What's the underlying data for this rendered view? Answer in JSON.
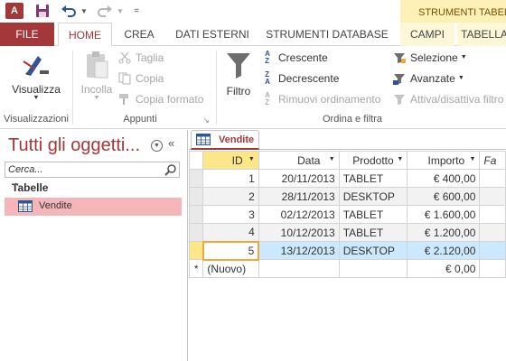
{
  "app": {
    "logo": "A",
    "context_tools_label": "STRUMENTI TABELLA"
  },
  "quick_access": {
    "save": "save-icon",
    "undo": "undo-icon",
    "redo": "redo-icon"
  },
  "tabs": {
    "file": "FILE",
    "home": "HOME",
    "crea": "CREA",
    "dati_esterni": "DATI ESTERNI",
    "strumenti_database": "STRUMENTI DATABASE",
    "campi": "CAMPI",
    "tabella": "TABELLA"
  },
  "ribbon": {
    "visualizzazioni": {
      "label": "Visualizzazioni",
      "visualizza": "Visualizza"
    },
    "appunti": {
      "label": "Appunti",
      "incolla": "Incolla",
      "taglia": "Taglia",
      "copia": "Copia",
      "copia_formato": "Copia formato"
    },
    "ordina": {
      "label": "Ordina e filtra",
      "filtro": "Filtro",
      "crescente": "Crescente",
      "decrescente": "Decrescente",
      "rimuovi": "Rimuovi ordinamento",
      "selezione": "Selezione",
      "avanzate": "Avanzate",
      "attiva": "Attiva/disattiva filtro"
    }
  },
  "nav": {
    "title": "Tutti gli oggetti...",
    "search_placeholder": "Cerca...",
    "group": "Tabelle",
    "items": [
      "Vendite"
    ]
  },
  "document": {
    "tab_label": "Vendite",
    "columns": [
      "ID",
      "Data",
      "Prodotto",
      "Importo",
      "Fa"
    ],
    "rows": [
      {
        "id": "1",
        "data": "20/11/2013",
        "prodotto": "TABLET",
        "importo": "€ 400,00"
      },
      {
        "id": "2",
        "data": "28/11/2013",
        "prodotto": "DESKTOP",
        "importo": "€ 600,00"
      },
      {
        "id": "3",
        "data": "02/12/2013",
        "prodotto": "TABLET",
        "importo": "€ 1.600,00"
      },
      {
        "id": "4",
        "data": "10/12/2013",
        "prodotto": "TABLET",
        "importo": "€ 1.200,00"
      },
      {
        "id": "5",
        "data": "13/12/2013",
        "prodotto": "DESKTOP",
        "importo": "€ 2.120,00"
      }
    ],
    "new_row": {
      "marker": "*",
      "id": "(Nuovo)",
      "importo": "€ 0,00"
    }
  },
  "colors": {
    "accent": "#a4373a",
    "context_tab": "#fdf1b8",
    "selected_row": "#cce8ff",
    "nav_selected": "#f4b6b9"
  }
}
